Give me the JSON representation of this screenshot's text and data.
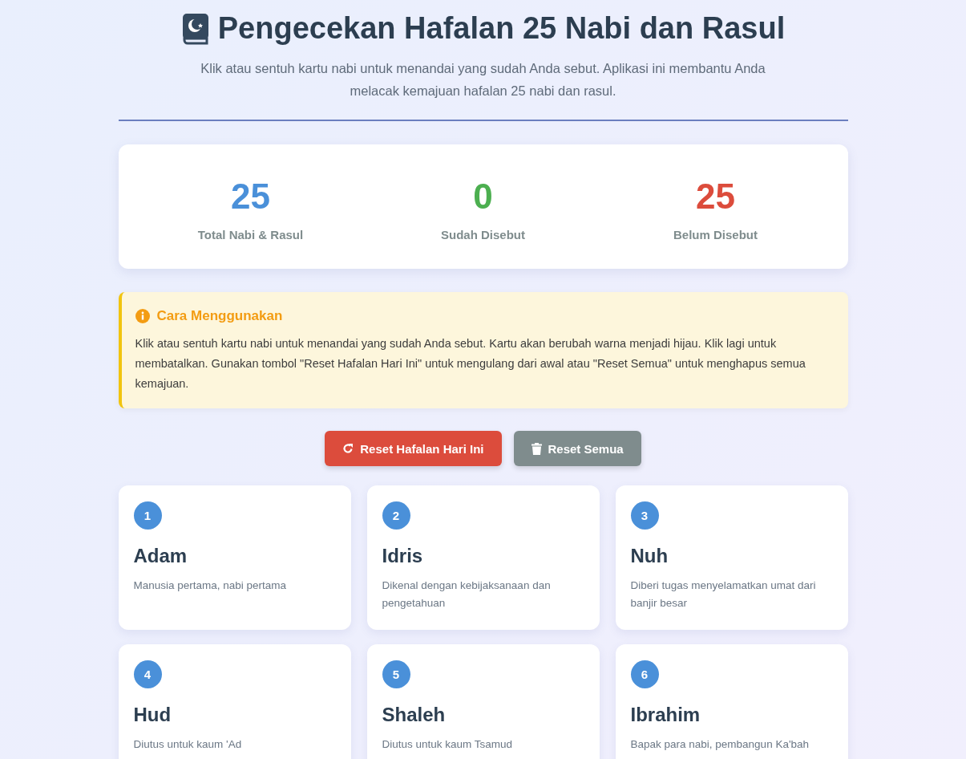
{
  "header": {
    "title": "Pengecekan Hafalan 25 Nabi dan Rasul",
    "subtitle": "Klik atau sentuh kartu nabi untuk menandai yang sudah Anda sebut. Aplikasi ini membantu Anda melacak kemajuan hafalan 25 nabi dan rasul."
  },
  "stats": [
    {
      "value": "25",
      "label": "Total Nabi & Rasul",
      "color": "#4a90d9"
    },
    {
      "value": "0",
      "label": "Sudah Disebut",
      "color": "#4caf50"
    },
    {
      "value": "25",
      "label": "Belum Disebut",
      "color": "#dc4c3c"
    }
  ],
  "info": {
    "title": "Cara Menggunakan",
    "text": "Klik atau sentuh kartu nabi untuk menandai yang sudah Anda sebut. Kartu akan berubah warna menjadi hijau. Klik lagi untuk membatalkan. Gunakan tombol \"Reset Hafalan Hari Ini\" untuk mengulang dari awal atau \"Reset Semua\" untuk menghapus semua kemajuan."
  },
  "buttons": [
    {
      "label": "Reset Hafalan Hari Ini",
      "kind": "reset-today"
    },
    {
      "label": "Reset Semua",
      "kind": "reset-all"
    }
  ],
  "prophets": [
    {
      "number": "1",
      "name": "Adam",
      "description": "Manusia pertama, nabi pertama",
      "checked": false
    },
    {
      "number": "2",
      "name": "Idris",
      "description": "Dikenal dengan kebijaksanaan dan pengetahuan",
      "checked": false
    },
    {
      "number": "3",
      "name": "Nuh",
      "description": "Diberi tugas menyelamatkan umat dari banjir besar",
      "checked": false
    },
    {
      "number": "4",
      "name": "Hud",
      "description": "Diutus untuk kaum 'Ad",
      "checked": false
    },
    {
      "number": "5",
      "name": "Shaleh",
      "description": "Diutus untuk kaum Tsamud",
      "checked": false
    },
    {
      "number": "6",
      "name": "Ibrahim",
      "description": "Bapak para nabi, pembangun Ka'bah",
      "checked": false
    }
  ]
}
